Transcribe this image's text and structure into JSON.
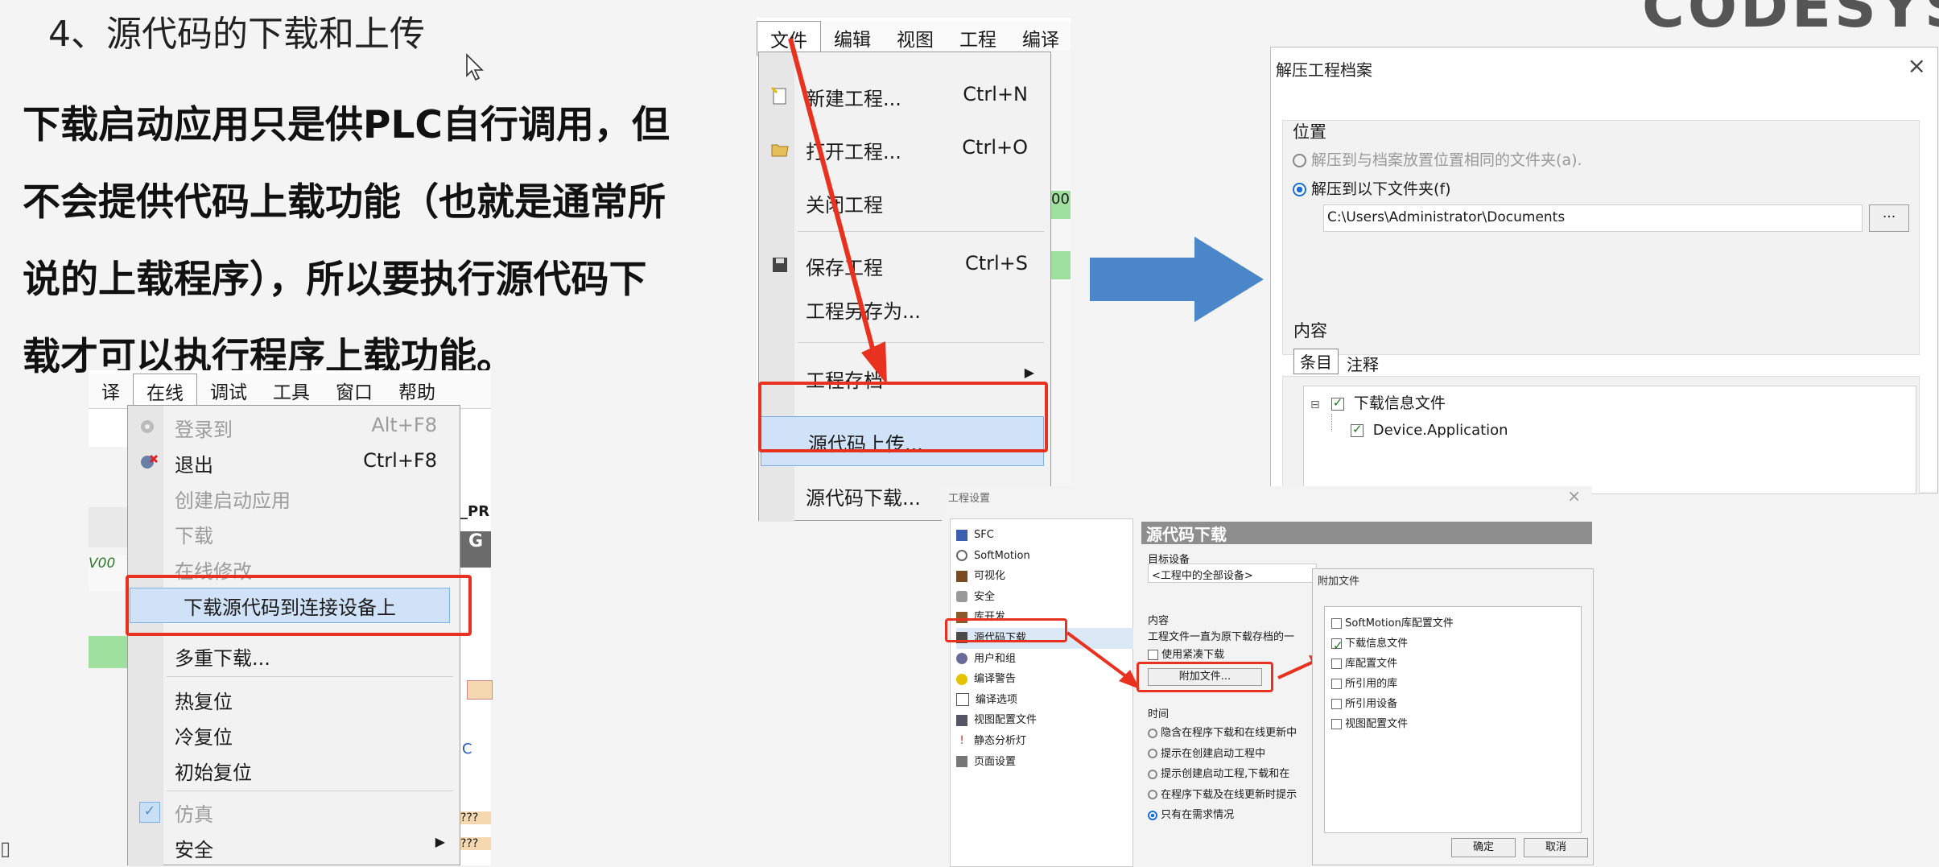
{
  "slide": {
    "title": "4、源代码的下载和上传",
    "body_lines": [
      "下载启动应用只是供PLC自行调用，但",
      "不会提供代码上载功能（也就是通常所",
      "说的上载程序），所以要执行源代码下",
      "载才可以执行程序上载功能。"
    ],
    "logo": "CODESYS"
  },
  "online_window": {
    "menubar": [
      "译",
      "在线",
      "调试",
      "工具",
      "窗口",
      "帮助"
    ],
    "active_menu": "在线",
    "side_labels": [
      "_PR",
      "G",
      "V00",
      "C",
      "???",
      "???"
    ],
    "items": [
      {
        "label": "登录到",
        "shortcut": "Alt+F8",
        "disabled": true,
        "icon": "login-icon"
      },
      {
        "label": "退出",
        "shortcut": "Ctrl+F8",
        "disabled": false,
        "icon": "logout-icon"
      },
      {
        "label": "创建启动应用",
        "shortcut": "",
        "disabled": true
      },
      {
        "label": "下载",
        "shortcut": "",
        "disabled": true
      },
      {
        "label": "在线修改",
        "shortcut": "",
        "disabled": true
      },
      {
        "label": "下载源代码到连接设备上",
        "shortcut": "",
        "disabled": false,
        "highlighted": true
      },
      {
        "label": "多重下载...",
        "shortcut": "",
        "disabled": false
      },
      {
        "label": "热复位",
        "shortcut": "",
        "disabled": false
      },
      {
        "label": "冷复位",
        "shortcut": "",
        "disabled": false
      },
      {
        "label": "初始复位",
        "shortcut": "",
        "disabled": false
      },
      {
        "label": "仿真",
        "shortcut": "",
        "disabled": true,
        "icon": "check-icon"
      },
      {
        "label": "安全",
        "shortcut": "",
        "disabled": false,
        "submenu": true
      }
    ]
  },
  "file_window": {
    "menubar": [
      "文件",
      "编辑",
      "视图",
      "工程",
      "编译"
    ],
    "active_menu": "文件",
    "side_labels": [
      "00"
    ],
    "items": [
      {
        "label": "新建工程...",
        "shortcut": "Ctrl+N",
        "icon": "new-project-icon"
      },
      {
        "label": "打开工程...",
        "shortcut": "Ctrl+O",
        "icon": "open-folder-icon"
      },
      {
        "label": "关闭工程",
        "shortcut": ""
      },
      {
        "label": "保存工程",
        "shortcut": "Ctrl+S",
        "icon": "save-icon"
      },
      {
        "label": "工程另存为...",
        "shortcut": ""
      },
      {
        "label": "工程存档",
        "shortcut": "",
        "submenu": true
      },
      {
        "label": "源代码上传...",
        "shortcut": "",
        "highlighted": true
      },
      {
        "label": "源代码下载...",
        "shortcut": ""
      }
    ]
  },
  "extract_dialog": {
    "title": "解压工程档案",
    "location_label": "位置",
    "option1": "解压到与档案放置位置相同的文件夹(a).",
    "option2": "解压到以下文件夹(f)",
    "path": "C:\\Users\\Administrator\\Documents",
    "browse": "...",
    "content_label": "内容",
    "tabs": [
      "条目",
      "注释"
    ],
    "tree": [
      {
        "label": "下载信息文件",
        "checked": true,
        "expander": "⊟"
      },
      {
        "label": "Device.Application",
        "checked": true
      }
    ]
  },
  "project_settings": {
    "title": "工程设置",
    "sidebar": [
      {
        "label": "SFC",
        "icon": "sfc-icon"
      },
      {
        "label": "SoftMotion",
        "icon": "softmotion-icon"
      },
      {
        "label": "可视化",
        "icon": "visualization-icon"
      },
      {
        "label": "安全",
        "icon": "security-icon"
      },
      {
        "label": "库开发",
        "icon": "library-icon"
      },
      {
        "label": "源代码下载",
        "icon": "source-download-icon",
        "selected": true
      },
      {
        "label": "用户和组",
        "icon": "users-icon"
      },
      {
        "label": "编译警告",
        "icon": "warning-icon"
      },
      {
        "label": "编译选项",
        "icon": "compile-icon"
      },
      {
        "label": "视图配置文件",
        "icon": "view-profile-icon"
      },
      {
        "label": "静态分析灯",
        "icon": "analysis-icon"
      },
      {
        "label": "页面设置",
        "icon": "page-setup-icon"
      }
    ],
    "panel_title": "源代码下载",
    "target_label": "目标设备",
    "target_value": "<工程中的全部设备>",
    "content_label": "内容",
    "content_desc": "工程文件一直为原下载存档的一",
    "compact_label": "使用紧凑下载",
    "attach_button": "附加文件...",
    "timing_label": "时间",
    "timing_options": [
      {
        "label": "隐含在程序下载和在线更新中",
        "selected": false
      },
      {
        "label": "提示在创建启动工程中",
        "selected": false
      },
      {
        "label": "提示创建启动工程,下载和在",
        "selected": false
      },
      {
        "label": "在程序下载及在线更新时提示",
        "selected": false
      },
      {
        "label": "只有在需求情况",
        "selected": true
      }
    ]
  },
  "attach_dialog": {
    "title": "附加文件",
    "items": [
      {
        "label": "SoftMotion库配置文件",
        "checked": false
      },
      {
        "label": "下载信息文件",
        "checked": true
      },
      {
        "label": "库配置文件",
        "checked": false
      },
      {
        "label": "所引用的库",
        "checked": false
      },
      {
        "label": "所引用设备",
        "checked": false
      },
      {
        "label": "视图配置文件",
        "checked": false
      }
    ],
    "ok": "确定",
    "cancel": "取消"
  },
  "colors": {
    "red": "#e8321f",
    "blue_arrow": "#4a86c8",
    "highlight": "#cfe2f7"
  }
}
